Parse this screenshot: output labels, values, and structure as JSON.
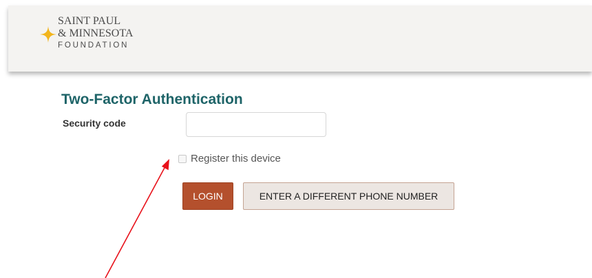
{
  "header": {
    "logo_line1": "SAINT PAUL",
    "logo_line2": "& MINNESOTA",
    "logo_line3": "FOUNDATION",
    "logo_icon": "four-point-star-icon",
    "star_color": "#f2b51d"
  },
  "form": {
    "title": "Two-Factor Authentication",
    "security_code_label": "Security code",
    "security_code_value": "",
    "register_device_label": "Register this device",
    "register_device_checked": false,
    "login_button": "LOGIN",
    "different_phone_button": "ENTER A DIFFERENT PHONE NUMBER"
  },
  "annotation": {
    "type": "red-arrow",
    "color": "#e8111a",
    "points_to": "register-device-checkbox"
  },
  "colors": {
    "title": "#1e6468",
    "login_button": "#b4502d",
    "secondary_button": "#ece6e2",
    "header_background": "#f4f3f1"
  }
}
